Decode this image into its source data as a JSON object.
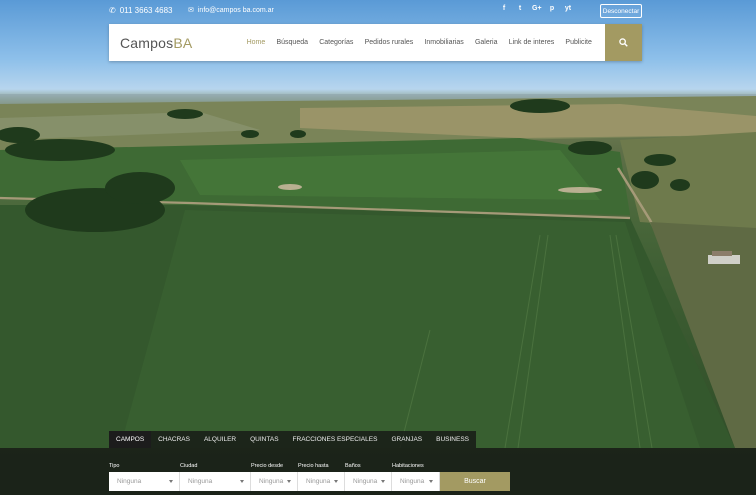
{
  "topbar": {
    "phone": "011 3663 4683",
    "email": "info@campos ba.com.ar",
    "social": [
      "f",
      "t",
      "G+",
      "p",
      "yt"
    ],
    "social_icons": [
      "facebook-icon",
      "twitter-icon",
      "google-plus-icon",
      "pinterest-icon",
      "youtube-icon"
    ],
    "logout_label": "Desconectar"
  },
  "nav": {
    "logo_main": "Campos",
    "logo_accent": "BA",
    "items": [
      "Home",
      "Búsqueda",
      "Categorías",
      "Pedidos rurales",
      "Inmobiliarias",
      "Galeria",
      "Link de interes",
      "Publicite"
    ],
    "active_index": 0
  },
  "tabs": {
    "items": [
      "CAMPOS",
      "CHACRAS",
      "ALQUILER",
      "QUINTAS",
      "FRACCIONES ESPECIALES",
      "GRANJAS",
      "BUSINESS"
    ],
    "active_index": 0
  },
  "search": {
    "labels": [
      "Tipo",
      "Ciudad",
      "Precio desde",
      "Precio hasta",
      "Baños",
      "Habitaciones"
    ],
    "values": [
      "Ninguna",
      "Ninguna",
      "Ninguna",
      "Ninguna",
      "Ninguna",
      "Ninguna"
    ],
    "submit_label": "Buscar"
  },
  "colors": {
    "accent": "#a39a62",
    "panel": "#1c1c1c"
  }
}
